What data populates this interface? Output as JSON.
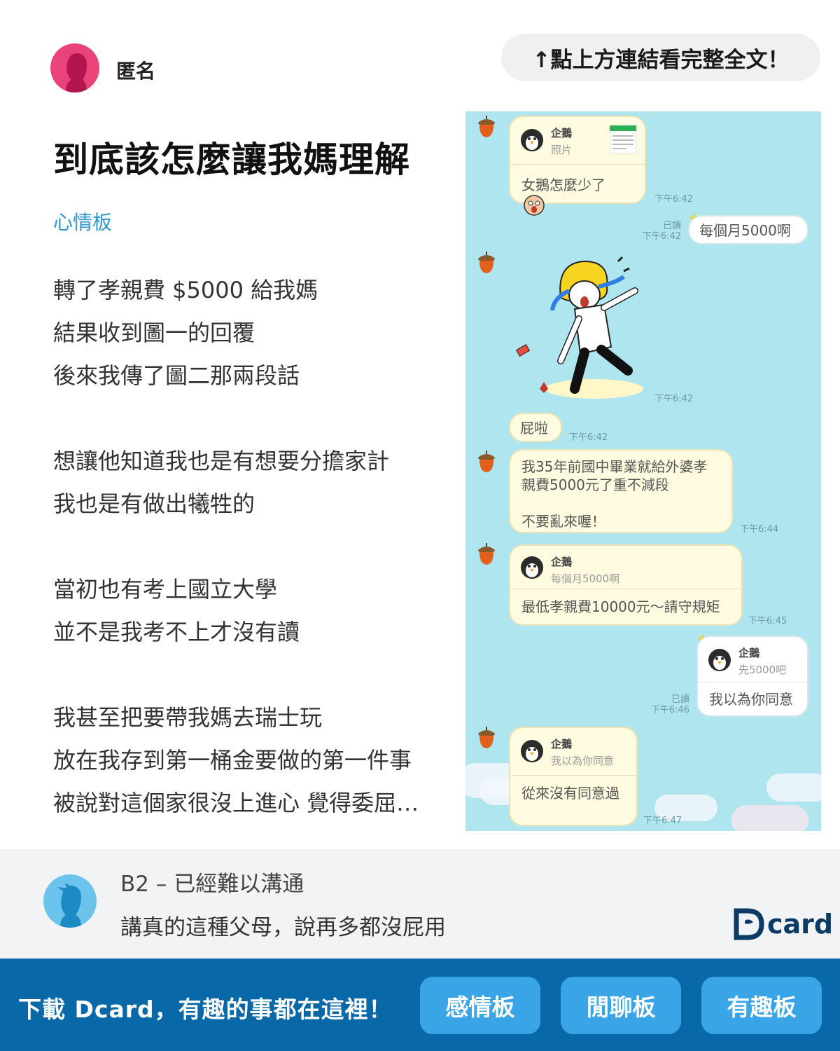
{
  "header": {
    "author_name": "匿名",
    "read_more": "↑點上方連結看完整全文！"
  },
  "post": {
    "title": "到底該怎麼讓我媽理解",
    "board": "心情板",
    "lines": [
      "轉了孝親費 $5000 給我媽",
      "結果收到圖一的回覆",
      "後來我傳了圖二那兩段話",
      "",
      "想讓他知道我也是有想要分擔家計",
      "我也是有做出犧牲的",
      "",
      "當初也有考上國立大學",
      "並不是我考不上才沒有讀",
      "",
      "我甚至把要帶我媽去瑞士玩",
      "放在我存到第一桶金要做的第一件事",
      "被說對這個家很沒上進心 覺得委屈…"
    ]
  },
  "chat": {
    "messages": [
      {
        "quote_name": "企鵝",
        "quote_sub": "照片",
        "text": "女鵝怎麼少了",
        "time": "下午6:42"
      },
      {
        "text": "每個月5000啊",
        "read": "已讀",
        "time": "下午6:42"
      },
      {
        "time": "下午6:42"
      },
      {
        "text": "屁啦",
        "time": "下午6:42"
      },
      {
        "text_lines": [
          "我35年前國中畢業就給外婆孝",
          "親費5000元了重不減段",
          "",
          "不要亂來喔！"
        ],
        "time": "下午6:44"
      },
      {
        "quote_name": "企鵝",
        "quote_sub": "每個月5000啊",
        "text": "最低孝親費10000元～請守規矩",
        "time": "下午6:45"
      },
      {
        "quote_name": "企鵝",
        "quote_sub": "先5000吧",
        "text": "我以為你同意",
        "read": "已讀",
        "time": "下午6:46"
      },
      {
        "quote_name": "企鵝",
        "quote_sub": "我以為你同意",
        "text": "從來沒有同意過",
        "time": "下午6:47"
      }
    ]
  },
  "comment": {
    "meta": "B2 – 已經難以溝通",
    "text": "講真的這種父母，說再多都沒屁用",
    "logo_word": "card"
  },
  "footer": {
    "slogan": "下載 Dcard，有趣的事都在這裡！",
    "buttons": [
      "感情板",
      "閒聊板",
      "有趣板"
    ]
  },
  "colors": {
    "board_blue": "#3397cf",
    "footer_blue": "#0868a8",
    "button_blue": "#3aa5e6",
    "chat_bg": "#aee5ee",
    "author_avatar": "#e9437a"
  }
}
